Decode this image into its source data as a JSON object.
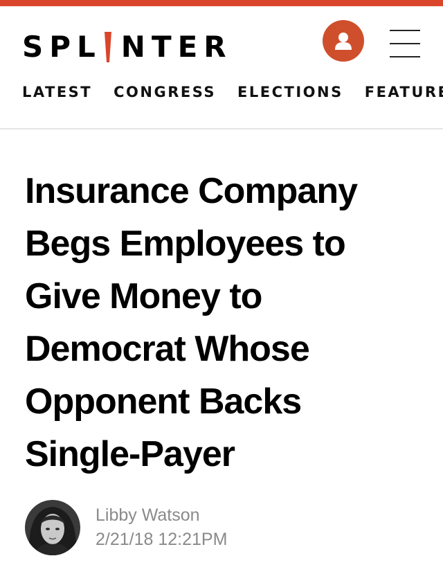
{
  "brand": {
    "logo_left": "SPL",
    "logo_right": "NTER",
    "accent_color": "#d9462b"
  },
  "header": {
    "account_icon": "user-icon",
    "menu_icon": "hamburger-menu-icon"
  },
  "nav": {
    "items": [
      {
        "label": "LATEST"
      },
      {
        "label": "CONGRESS"
      },
      {
        "label": "ELECTIONS"
      },
      {
        "label": "FEATURES"
      }
    ]
  },
  "article": {
    "title": "Insurance Company Begs Employees to Give Money to Democrat Whose Opponent Backs Single-Payer",
    "author": "Libby Watson",
    "timestamp": "2/21/18 12:21PM"
  }
}
